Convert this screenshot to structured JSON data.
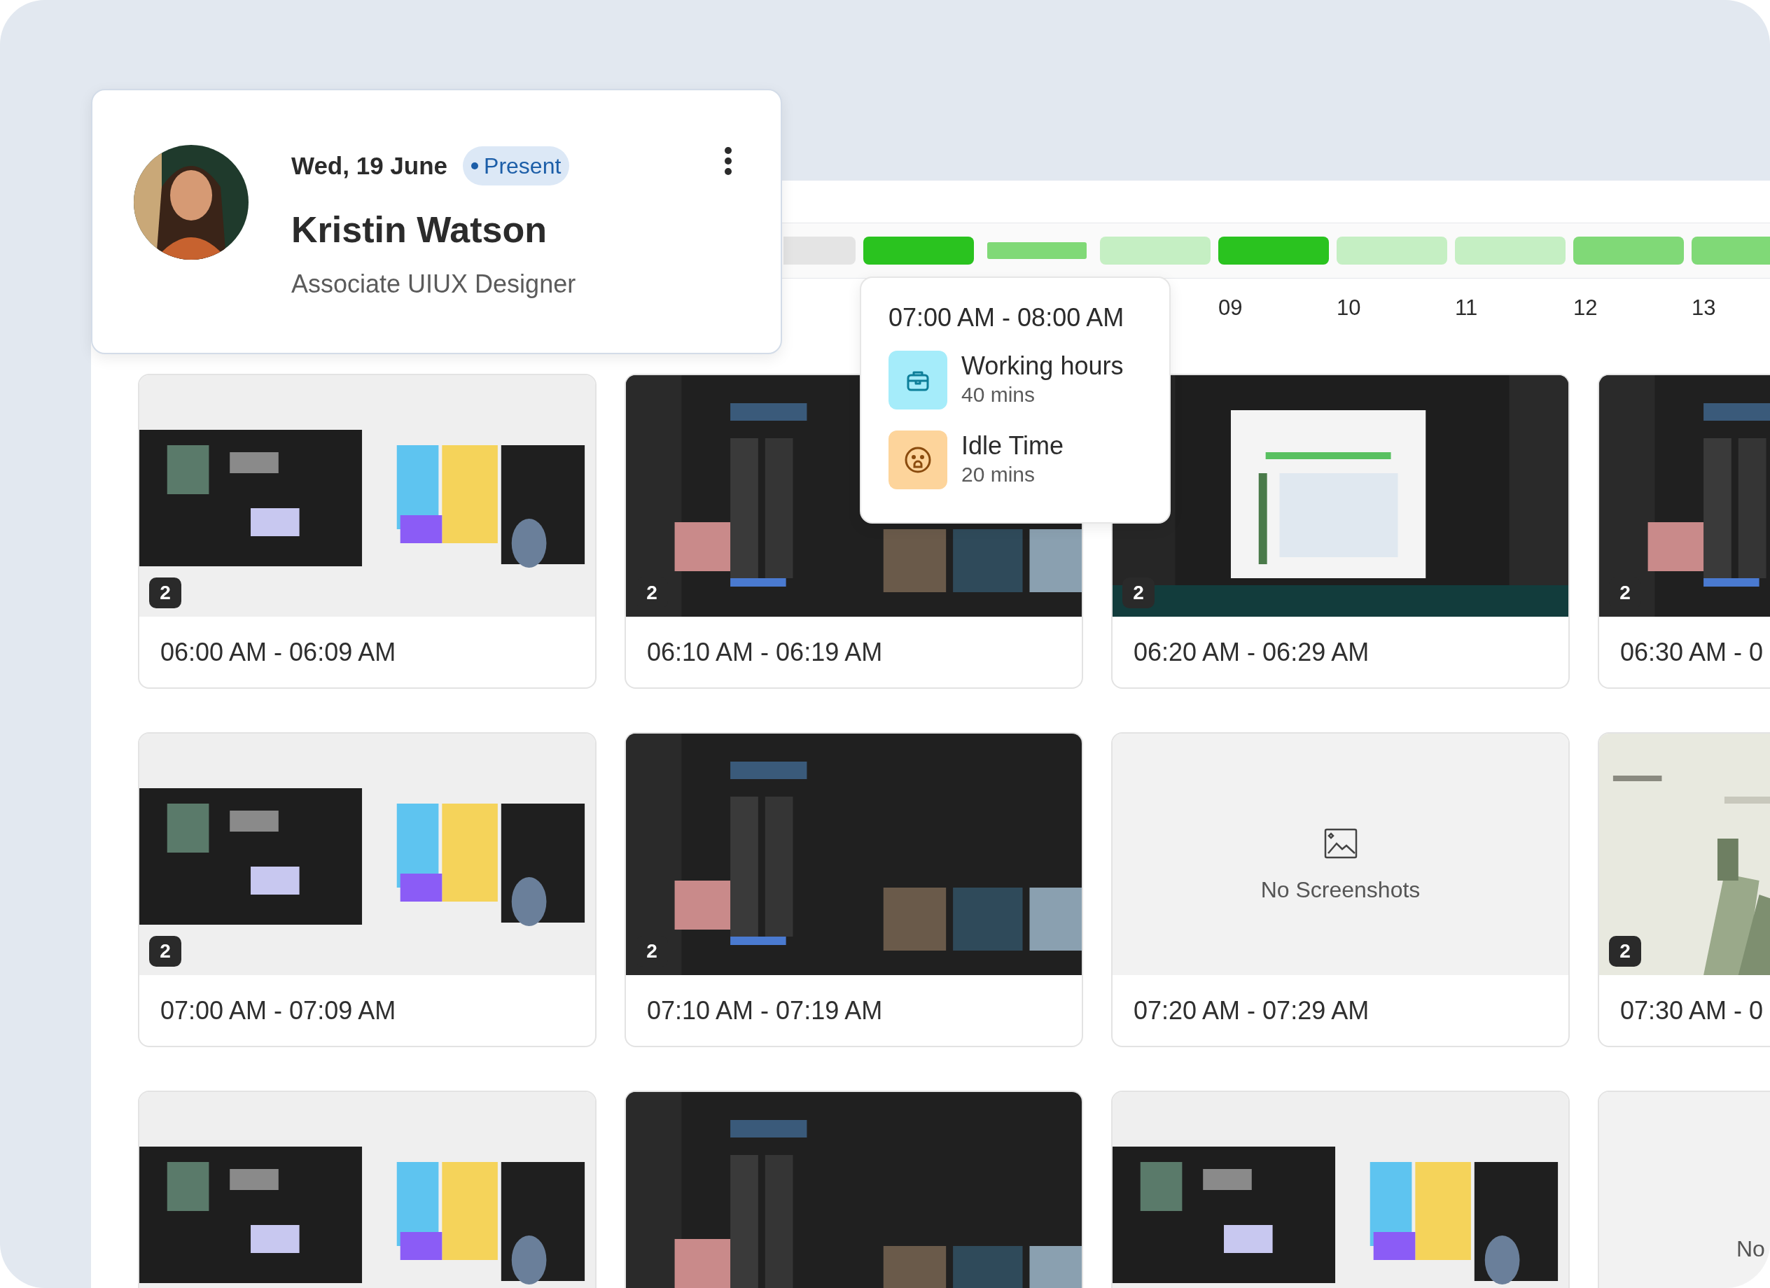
{
  "profile": {
    "date": "Wed, 19 June",
    "status": "Present",
    "name": "Kristin Watson",
    "role": "Associate UIUX Designer"
  },
  "timeline": [
    {
      "kind": "bar",
      "color": "#e4e4e4"
    },
    {
      "kind": "bar",
      "color": "#2ac31f"
    },
    {
      "kind": "thin",
      "color": "#80d977"
    },
    {
      "kind": "bar",
      "color": "#c5efc3"
    },
    {
      "kind": "bar",
      "color": "#2ac31f",
      "label": "09"
    },
    {
      "kind": "bar",
      "color": "#c5efc3",
      "label": "10"
    },
    {
      "kind": "bar",
      "color": "#c5efc3",
      "label": "11"
    },
    {
      "kind": "bar",
      "color": "#80d977",
      "label": "12"
    },
    {
      "kind": "bar",
      "color": "#80d977",
      "label": "13"
    }
  ],
  "tooltip": {
    "title": "07:00 AM - 08:00 AM",
    "items": [
      {
        "kind": "work",
        "label": "Working hours",
        "value": "40 mins"
      },
      {
        "kind": "idle",
        "label": "Idle Time",
        "value": "20 mins"
      }
    ]
  },
  "cards": [
    {
      "kind": "screenshot",
      "count": "2",
      "time": "06:00 AM - 06:09 AM"
    },
    {
      "kind": "screenshot",
      "count": "2",
      "time": "06:10 AM - 06:19 AM"
    },
    {
      "kind": "screenshot",
      "count": "2",
      "time": "06:20 AM - 06:29 AM"
    },
    {
      "kind": "screenshot",
      "count": "2",
      "time": "06:30 AM - 0"
    },
    {
      "kind": "screenshot",
      "count": "2",
      "time": "07:00 AM - 07:09 AM"
    },
    {
      "kind": "screenshot",
      "count": "2",
      "time": "07:10 AM - 07:19 AM"
    },
    {
      "kind": "empty",
      "message": "No Screenshots",
      "time": "07:20 AM - 07:29 AM"
    },
    {
      "kind": "screenshot",
      "count": "2",
      "time": "07:30 AM - 0"
    },
    {
      "kind": "screenshot"
    },
    {
      "kind": "screenshot"
    },
    {
      "kind": "screenshot"
    },
    {
      "kind": "empty",
      "message": "No"
    }
  ]
}
